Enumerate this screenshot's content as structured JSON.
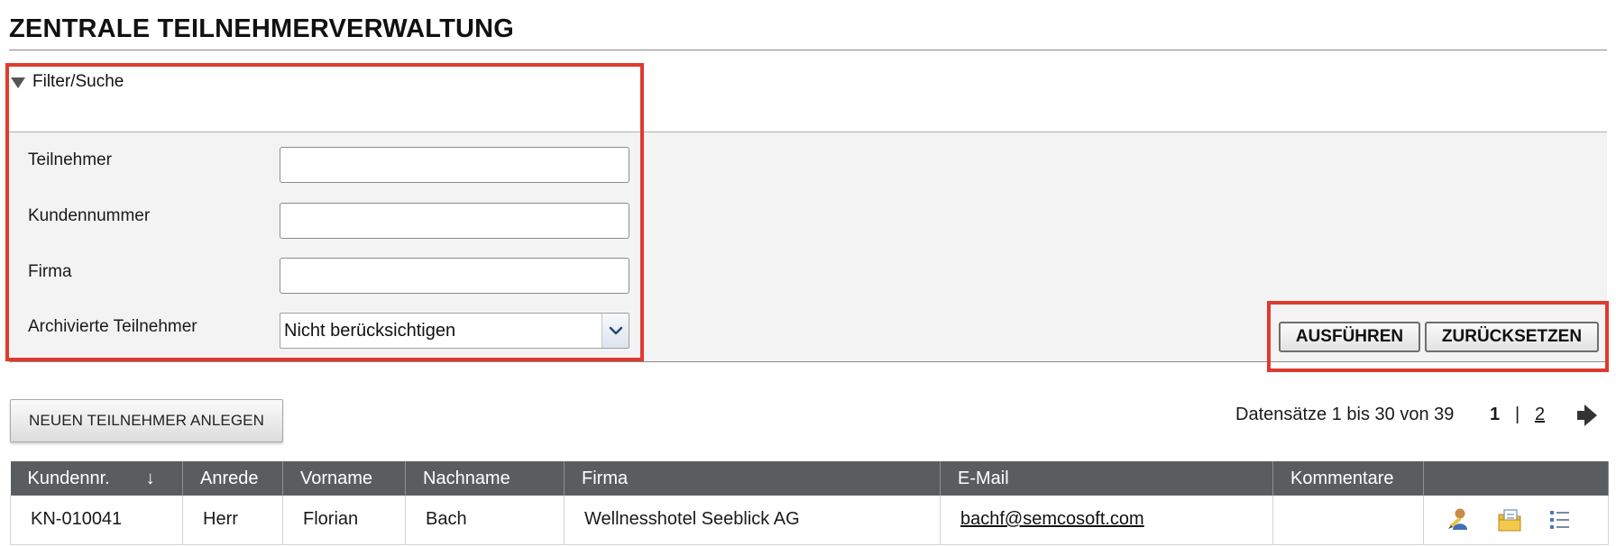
{
  "page": {
    "title": "ZENTRALE TEILNEHMERVERWALTUNG"
  },
  "filter": {
    "toggle_label": "Filter/Suche",
    "fields": [
      {
        "label": "Teilnehmer",
        "value": ""
      },
      {
        "label": "Kundennummer",
        "value": ""
      },
      {
        "label": "Firma",
        "value": ""
      }
    ],
    "archived": {
      "label": "Archivierte Teilnehmer",
      "selected": "Nicht berücksichtigen"
    },
    "execute_label": "AUSFÜHREN",
    "reset_label": "ZURÜCKSETZEN"
  },
  "toolbar": {
    "new_participant_label": "NEUEN TEILNEHMER ANLEGEN"
  },
  "pagination": {
    "summary": "Datensätze 1 bis 30 von 39",
    "current_page": "1",
    "separator": "|",
    "other_page": "2",
    "next_icon": "arrow-right-icon"
  },
  "table": {
    "columns": [
      "Kundennr.",
      "Anrede",
      "Vorname",
      "Nachname",
      "Firma",
      "E-Mail",
      "Kommentare",
      ""
    ],
    "sort_indicator": "↓",
    "rows": [
      {
        "customer_no": "KN-010041",
        "salutation": "Herr",
        "first_name": "Florian",
        "last_name": "Bach",
        "company": "Wellnesshotel Seeblick AG",
        "email": "bachf@semcosoft.com",
        "comments": "",
        "action_icons": [
          "user-edit-icon",
          "documents-icon",
          "list-icon"
        ]
      }
    ]
  },
  "colors": {
    "highlight": "#e03a2e",
    "table_header": "#5a5d60",
    "filter_panel": "#f3f3f3"
  }
}
